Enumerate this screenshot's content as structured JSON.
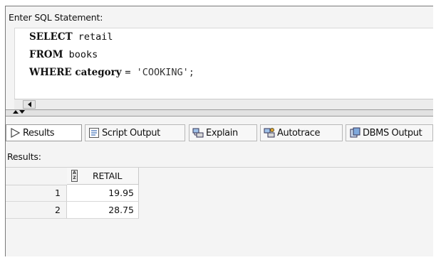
{
  "editor": {
    "label": "Enter SQL Statement:",
    "lines": [
      {
        "keyword": "SELECT",
        "rest": " retail"
      },
      {
        "keyword": "FROM",
        "rest": " books"
      },
      {
        "keyword": "WHERE",
        "bold_rest": " category ",
        "op": "= ",
        "string": "'COOKING';"
      }
    ]
  },
  "tabs": [
    {
      "label": "Results",
      "icon": "play-triangle-icon",
      "active": true
    },
    {
      "label": "Script Output",
      "icon": "script-output-icon"
    },
    {
      "label": "Explain",
      "icon": "explain-plan-icon"
    },
    {
      "label": "Autotrace",
      "icon": "autotrace-icon"
    },
    {
      "label": "DBMS Output",
      "icon": "dbms-output-icon"
    }
  ],
  "results": {
    "label": "Results:",
    "columns": [
      "RETAIL"
    ],
    "rows": [
      {
        "num": "1",
        "retail": "19.95"
      },
      {
        "num": "2",
        "retail": "28.75"
      }
    ]
  }
}
